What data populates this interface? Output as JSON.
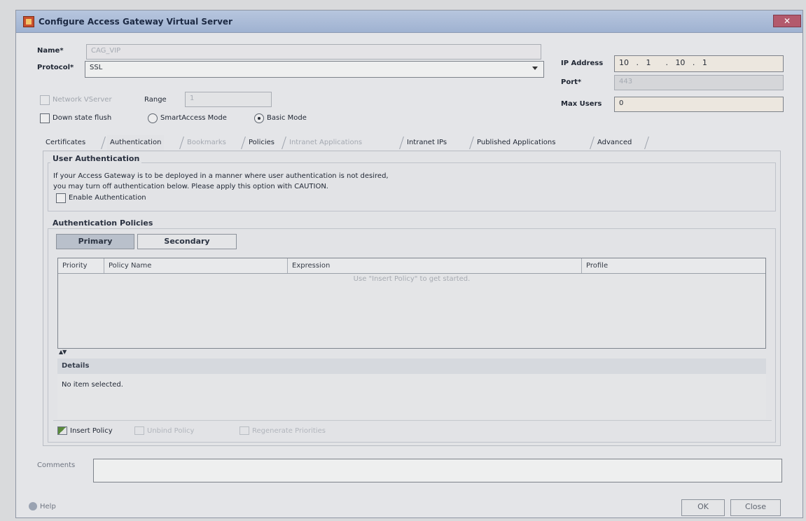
{
  "window": {
    "title": "Configure Access Gateway Virtual Server",
    "close_label": "✕"
  },
  "form": {
    "name_label": "Name*",
    "name_value": "CAG_VIP",
    "protocol_label": "Protocol*",
    "protocol_value": "SSL",
    "network_vserver_label": "Network VServer",
    "range_label": "Range",
    "range_value": "1",
    "down_state_flush_label": "Down state flush",
    "smartaccess_label": "SmartAccess Mode",
    "basic_mode_label": "Basic Mode",
    "mode_selected": "Basic Mode",
    "ip_address_label": "IP Address",
    "ip_address_value": "10   .   1      .   10   .   1",
    "port_label": "Port*",
    "port_value": "443",
    "max_users_label": "Max Users",
    "max_users_value": "0"
  },
  "tabs": [
    {
      "label": "Certificates",
      "state": "normal"
    },
    {
      "label": "Authentication",
      "state": "active"
    },
    {
      "label": "Bookmarks",
      "state": "disabled"
    },
    {
      "label": "Policies",
      "state": "normal"
    },
    {
      "label": "Intranet Applications",
      "state": "disabled"
    },
    {
      "label": "Intranet IPs",
      "state": "normal"
    },
    {
      "label": "Published Applications",
      "state": "normal"
    },
    {
      "label": "Advanced",
      "state": "normal"
    }
  ],
  "user_auth": {
    "title": "User Authentication",
    "line1": "If your Access Gateway is to be deployed in a manner where user authentication is not desired,",
    "line2": "you may turn off authentication below. Please apply this option with CAUTION.",
    "enable_label": "Enable Authentication"
  },
  "auth_policies": {
    "title": "Authentication Policies",
    "primary_label": "Primary",
    "secondary_label": "Secondary",
    "columns": [
      "Priority",
      "Policy Name",
      "Expression",
      "Profile"
    ],
    "empty_message": "Use \"Insert Policy\" to get started.",
    "details_title": "Details",
    "details_text": "No item selected.",
    "insert_label": "Insert Policy",
    "unbind_label": "Unbind Policy",
    "regenerate_label": "Regenerate Priorities"
  },
  "footer": {
    "comments_label": "Comments",
    "help_label": "Help",
    "ok_label": "OK",
    "close_label": "Close"
  }
}
